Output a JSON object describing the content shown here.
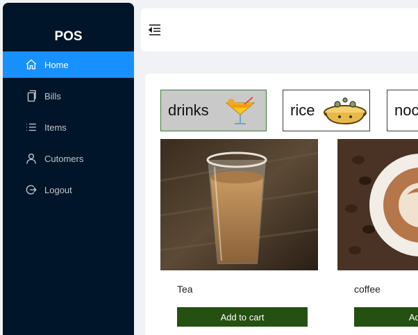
{
  "app": {
    "logo": "POS"
  },
  "sidebar": {
    "items": [
      {
        "label": "Home",
        "icon": "home-icon",
        "active": true
      },
      {
        "label": "Bills",
        "icon": "copy-icon"
      },
      {
        "label": "Items",
        "icon": "list-icon"
      },
      {
        "label": "Cutomers",
        "icon": "user-icon"
      },
      {
        "label": "Logout",
        "icon": "logout-icon"
      }
    ]
  },
  "header": {
    "toggle_icon": "menu-fold-icon"
  },
  "categories": [
    {
      "label": "drinks",
      "selected": true
    },
    {
      "label": "rice"
    },
    {
      "label": "noc"
    }
  ],
  "products": [
    {
      "name": "Tea",
      "button": "Add to cart"
    },
    {
      "name": "coffee",
      "button": "Add t"
    }
  ],
  "colors": {
    "sidebar_bg": "#001529",
    "active_item": "#1890ff",
    "cart_button": "#245011"
  }
}
